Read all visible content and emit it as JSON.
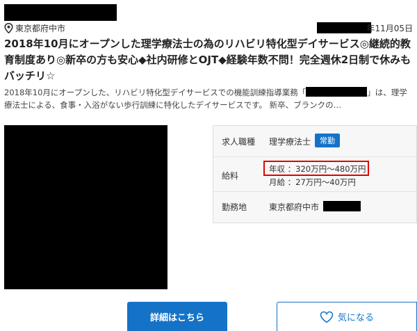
{
  "company": {
    "name_redacted": true
  },
  "location": {
    "icon": "map-pin-icon",
    "text": "東京都府中市"
  },
  "posted_date": {
    "text": "年11月05日"
  },
  "job": {
    "title": "2018年10月にオープンした理学療法士の為のリハビリ特化型デイサービス◎継続的教育制度あり◎新卒の方も安心◆社内研修とOJT◆経験年数不問！完全週休2日制で休みもバッチリ☆",
    "desc_part1": "2018年10月にオープンした、リハビリ特化型デイサービスでの機能訓練指導業務「",
    "desc_part2": "」は、理学療法士による、食事・入浴がない歩行訓練に特化したデイサービスです。 新卒、ブランクの…"
  },
  "info": {
    "rows": [
      {
        "label": "求人職種",
        "value": "理学療法士",
        "badge": "常勤"
      },
      {
        "label": "給料",
        "line1": "年収 ：320万円〜480万円",
        "line2": "月給 ：27万円〜40万円"
      },
      {
        "label": "勤務地",
        "value": "東京都府中市"
      }
    ]
  },
  "buttons": {
    "detail": "詳細はこちら",
    "favorite": "気になる",
    "favorite_icon": "heart-icon"
  },
  "colors": {
    "accent": "#1573c7",
    "highlight": "#e00000"
  }
}
